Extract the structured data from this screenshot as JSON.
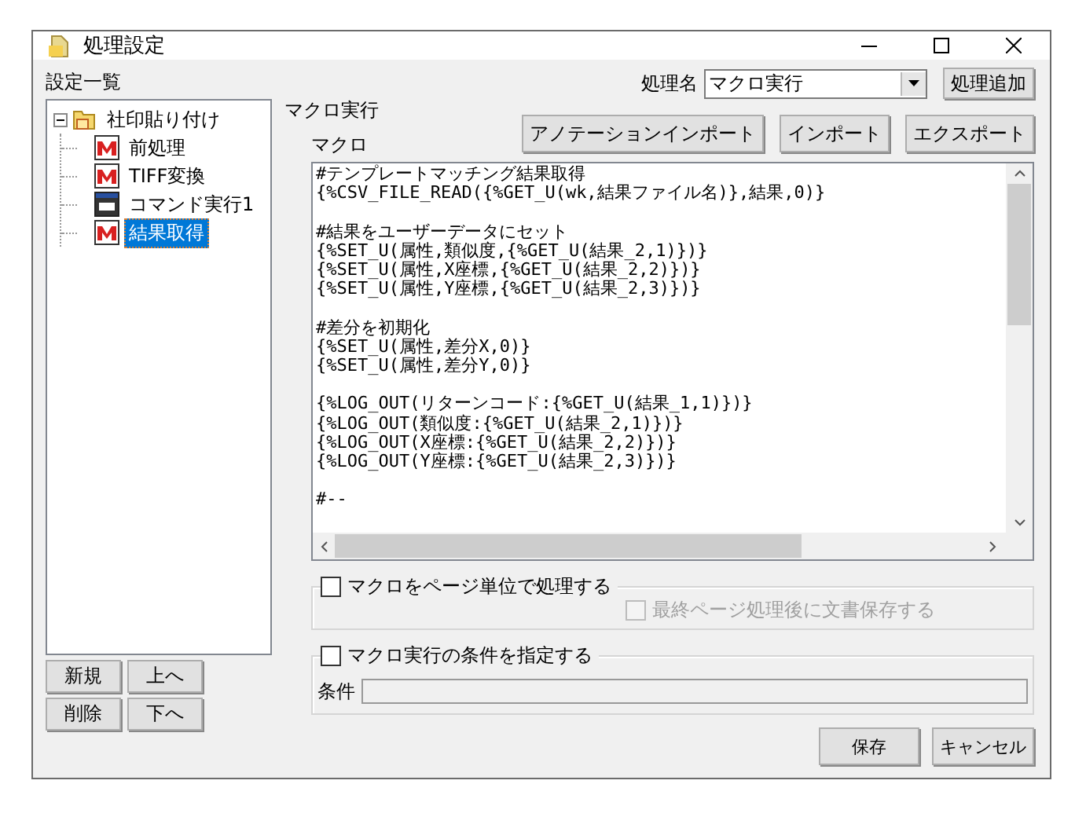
{
  "window": {
    "title": "処理設定"
  },
  "sidebar": {
    "label": "設定一覧",
    "tree": [
      {
        "label": "社印貼り付け",
        "kind": "folder",
        "expanded": true,
        "selected": false,
        "children": [
          {
            "label": "前処理",
            "kind": "macro",
            "selected": false
          },
          {
            "label": "TIFF変換",
            "kind": "macro",
            "selected": false
          },
          {
            "label": "コマンド実行1",
            "kind": "command",
            "selected": false
          },
          {
            "label": "結果取得",
            "kind": "macro",
            "selected": true
          }
        ]
      }
    ],
    "buttons": [
      [
        "新規",
        "上へ"
      ],
      [
        "削除",
        "下へ"
      ]
    ]
  },
  "process": {
    "label": "処理名",
    "value": "マクロ実行",
    "add_button": "処理追加"
  },
  "section_title": "マクロ実行",
  "macro": {
    "label": "マクロ",
    "buttons": [
      "アノテーションインポート",
      "インポート",
      "エクスポート"
    ],
    "code": "#テンプレートマッチング結果取得\n{%CSV_FILE_READ({%GET_U(wk,結果ファイル名)},結果,0)}\n\n#結果をユーザーデータにセット\n{%SET_U(属性,類似度,{%GET_U(結果_2,1)})}\n{%SET_U(属性,X座標,{%GET_U(結果_2,2)})}\n{%SET_U(属性,Y座標,{%GET_U(結果_2,3)})}\n\n#差分を初期化\n{%SET_U(属性,差分X,0)}\n{%SET_U(属性,差分Y,0)}\n\n{%LOG_OUT(リターンコード:{%GET_U(結果_1,1)})}\n{%LOG_OUT(類似度:{%GET_U(結果_2,1)})}\n{%LOG_OUT(X座標:{%GET_U(結果_2,2)})}\n{%LOG_OUT(Y座標:{%GET_U(結果_2,3)})}\n\n#--"
  },
  "page_unit": {
    "label": "マクロをページ単位で処理する",
    "checked": false,
    "save_after": {
      "label": "最終ページ処理後に文書保存する",
      "checked": false,
      "disabled": true
    }
  },
  "condition": {
    "label": "マクロ実行の条件を指定する",
    "checked": false,
    "field_label": "条件"
  },
  "footer_buttons": [
    "保存",
    "キャンセル"
  ]
}
